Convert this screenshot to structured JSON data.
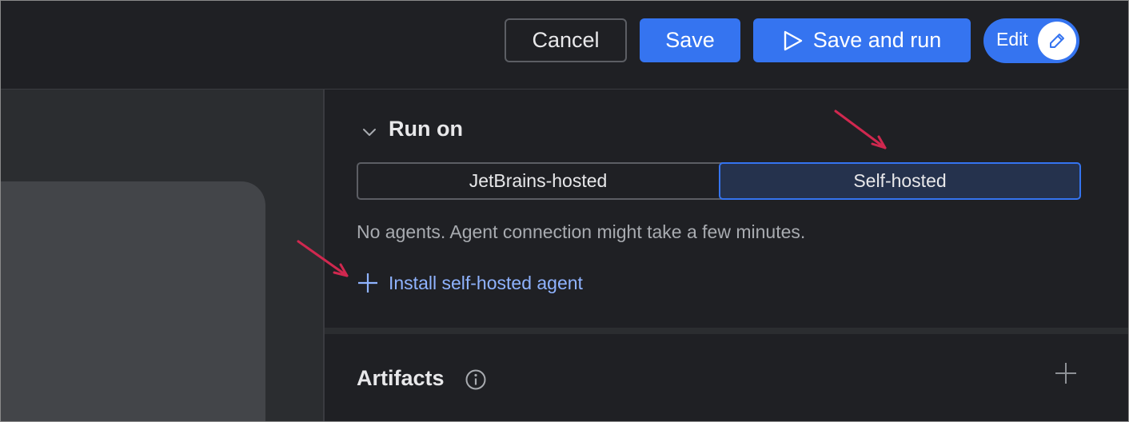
{
  "toolbar": {
    "cancel_label": "Cancel",
    "save_label": "Save",
    "save_and_run_label": "Save and run",
    "edit_label": "Edit"
  },
  "run_on": {
    "title": "Run on",
    "options": [
      "JetBrains-hosted",
      "Self-hosted"
    ],
    "selected": "Self-hosted",
    "note": "No agents. Agent connection might take a few minutes.",
    "install_link": "Install self-hosted agent"
  },
  "artifacts": {
    "title": "Artifacts"
  },
  "colors": {
    "accent": "#3574f0",
    "link": "#8fb3ff",
    "annotation_arrow": "#d0284f",
    "background": "#1f2024"
  },
  "icons": {
    "play": "play-icon",
    "edit": "pencil-icon",
    "collapse": "chevron-down-icon",
    "add": "plus-icon",
    "info": "info-icon"
  }
}
